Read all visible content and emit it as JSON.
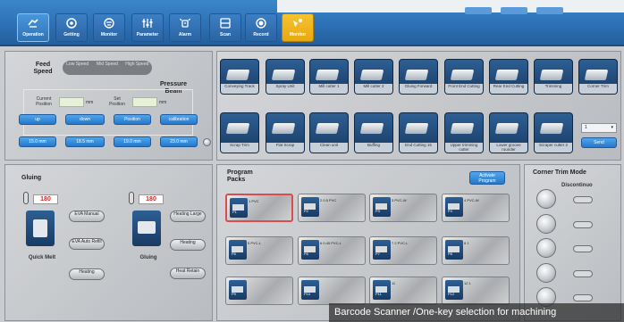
{
  "toolbar": {
    "buttons": [
      {
        "label": "Operation",
        "icon": "hand-icon"
      },
      {
        "label": "Getting",
        "icon": "gear-icon"
      },
      {
        "label": "Monitor",
        "icon": "monitor-icon"
      },
      {
        "label": "Parameter",
        "icon": "sliders-icon"
      },
      {
        "label": "Alarm",
        "icon": "alarm-icon"
      },
      {
        "label": "Scan",
        "icon": "scan-icon"
      },
      {
        "label": "Record",
        "icon": "record-icon"
      },
      {
        "label": "Monitor",
        "icon": "monitor-alt-icon"
      }
    ]
  },
  "feed": {
    "title": "Feed Speed",
    "options": [
      "Low Speed",
      "Mid Speed",
      "High Speed"
    ],
    "pressure_title": "Pressure Beam",
    "current_label": "Current Position",
    "set_label": "Set Position",
    "unit": "mm",
    "action_buttons": [
      "up",
      "down",
      "Position",
      "calibration"
    ],
    "size_buttons": [
      "15.0 mm",
      "18.5 mm",
      "19.0 mm",
      "23.0 mm"
    ]
  },
  "tools": {
    "row1": [
      "Conveying Track",
      "Spray Unit",
      "Mill cutter 1",
      "Mill cutter 2",
      "Gluing Forward",
      "Front End Cutting",
      "Rear End Cutting",
      "Trimming",
      "Corner Trim"
    ],
    "row2": [
      "Scrap Trim",
      "Flat Scrap",
      "Clean unit",
      "Buffing",
      "End Cutting 15",
      "Upper trimming cutter",
      "Lower groove rounder",
      "Scraper cutter 2"
    ],
    "select_value": "1",
    "send_label": "Send"
  },
  "gluing": {
    "title": "Gluing",
    "temp1": "180",
    "temp2": "180",
    "left_caption": "Quick Melt",
    "right_caption": "Gluing",
    "left_buttons": [
      "EVA Manual",
      "EVA Auto Refill",
      "Heating"
    ],
    "right_buttons": [
      "Heating Large",
      "Heating",
      "Heat Retain"
    ]
  },
  "program": {
    "title": "Program Packs",
    "activate_label": "Activate Program",
    "packs": [
      {
        "num": "P1",
        "label": "1 PVC"
      },
      {
        "num": "P2",
        "label": "2 0.5 PVC"
      },
      {
        "num": "P3",
        "label": "3 PVC-W"
      },
      {
        "num": "P4",
        "label": "4 PVC-W"
      },
      {
        "num": "P5",
        "label": "5 PVC-L"
      },
      {
        "num": "P6",
        "label": "6 0.45 PVC-L"
      },
      {
        "num": "P7",
        "label": "7 2 PVC-L"
      },
      {
        "num": "P8",
        "label": "8 1"
      },
      {
        "num": "P9",
        "label": ""
      },
      {
        "num": "P10",
        "label": ""
      },
      {
        "num": "P11",
        "label": "11"
      },
      {
        "num": "P12",
        "label": "12 1"
      }
    ]
  },
  "corner": {
    "title": "Corner Trim  Mode",
    "status": "Discontinuo"
  },
  "caption": "Barcode Scanner /One-key selection for machining"
}
